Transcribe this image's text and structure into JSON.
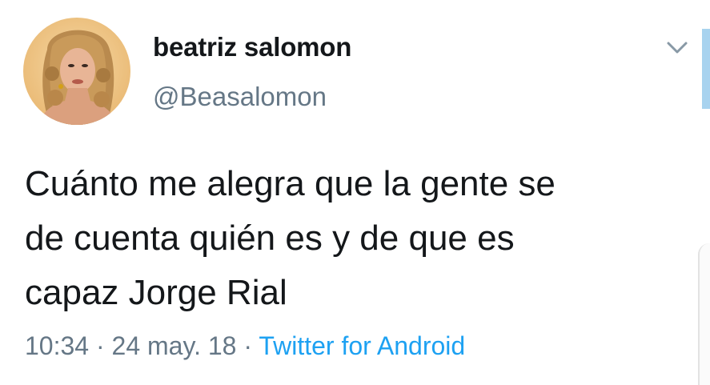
{
  "tweet": {
    "display_name": "beatriz salomon",
    "handle": "@Beasalomon",
    "text": "Cuánto me alegra que la gente se\nde cuenta quién es  y de que es\ncapaz Jorge Rial",
    "time": "10:34",
    "date": "24 may. 18",
    "source": "Twitter for Android",
    "separator": " · "
  },
  "icons": {
    "avatar": "profile-photo",
    "caret": "chevron-down-icon"
  },
  "colors": {
    "text": "#14171a",
    "secondary": "#657786",
    "link": "#1da1f2"
  }
}
